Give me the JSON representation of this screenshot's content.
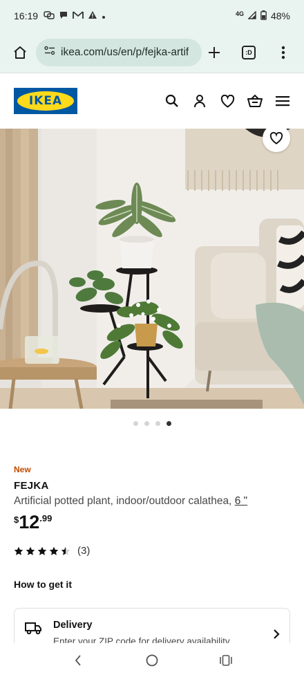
{
  "status_bar": {
    "time": "16:19",
    "network": "4G",
    "battery": "48%"
  },
  "browser": {
    "url": "ikea.com/us/en/p/fejka-artif",
    "tab_badge": ":D"
  },
  "site": {
    "logo_text": "IKEA"
  },
  "carousel": {
    "count": 4,
    "active_index": 3
  },
  "product": {
    "badge": "New",
    "name": "FEJKA",
    "description": "Artificial potted plant, indoor/outdoor calathea,",
    "size": "6 \"",
    "price_currency": "$",
    "price_integer": "12",
    "price_decimal": ".99",
    "rating_value": 4.5,
    "review_count": "(3)"
  },
  "fulfillment": {
    "section_title": "How to get it",
    "delivery_title": "Delivery",
    "delivery_subtitle": "Enter your ZIP code for delivery availability"
  },
  "colors": {
    "ikea_blue": "#0058a3",
    "ikea_yellow": "#ffda1a",
    "new_badge": "#c24a00",
    "browser_bg": "#e9f3ef"
  }
}
